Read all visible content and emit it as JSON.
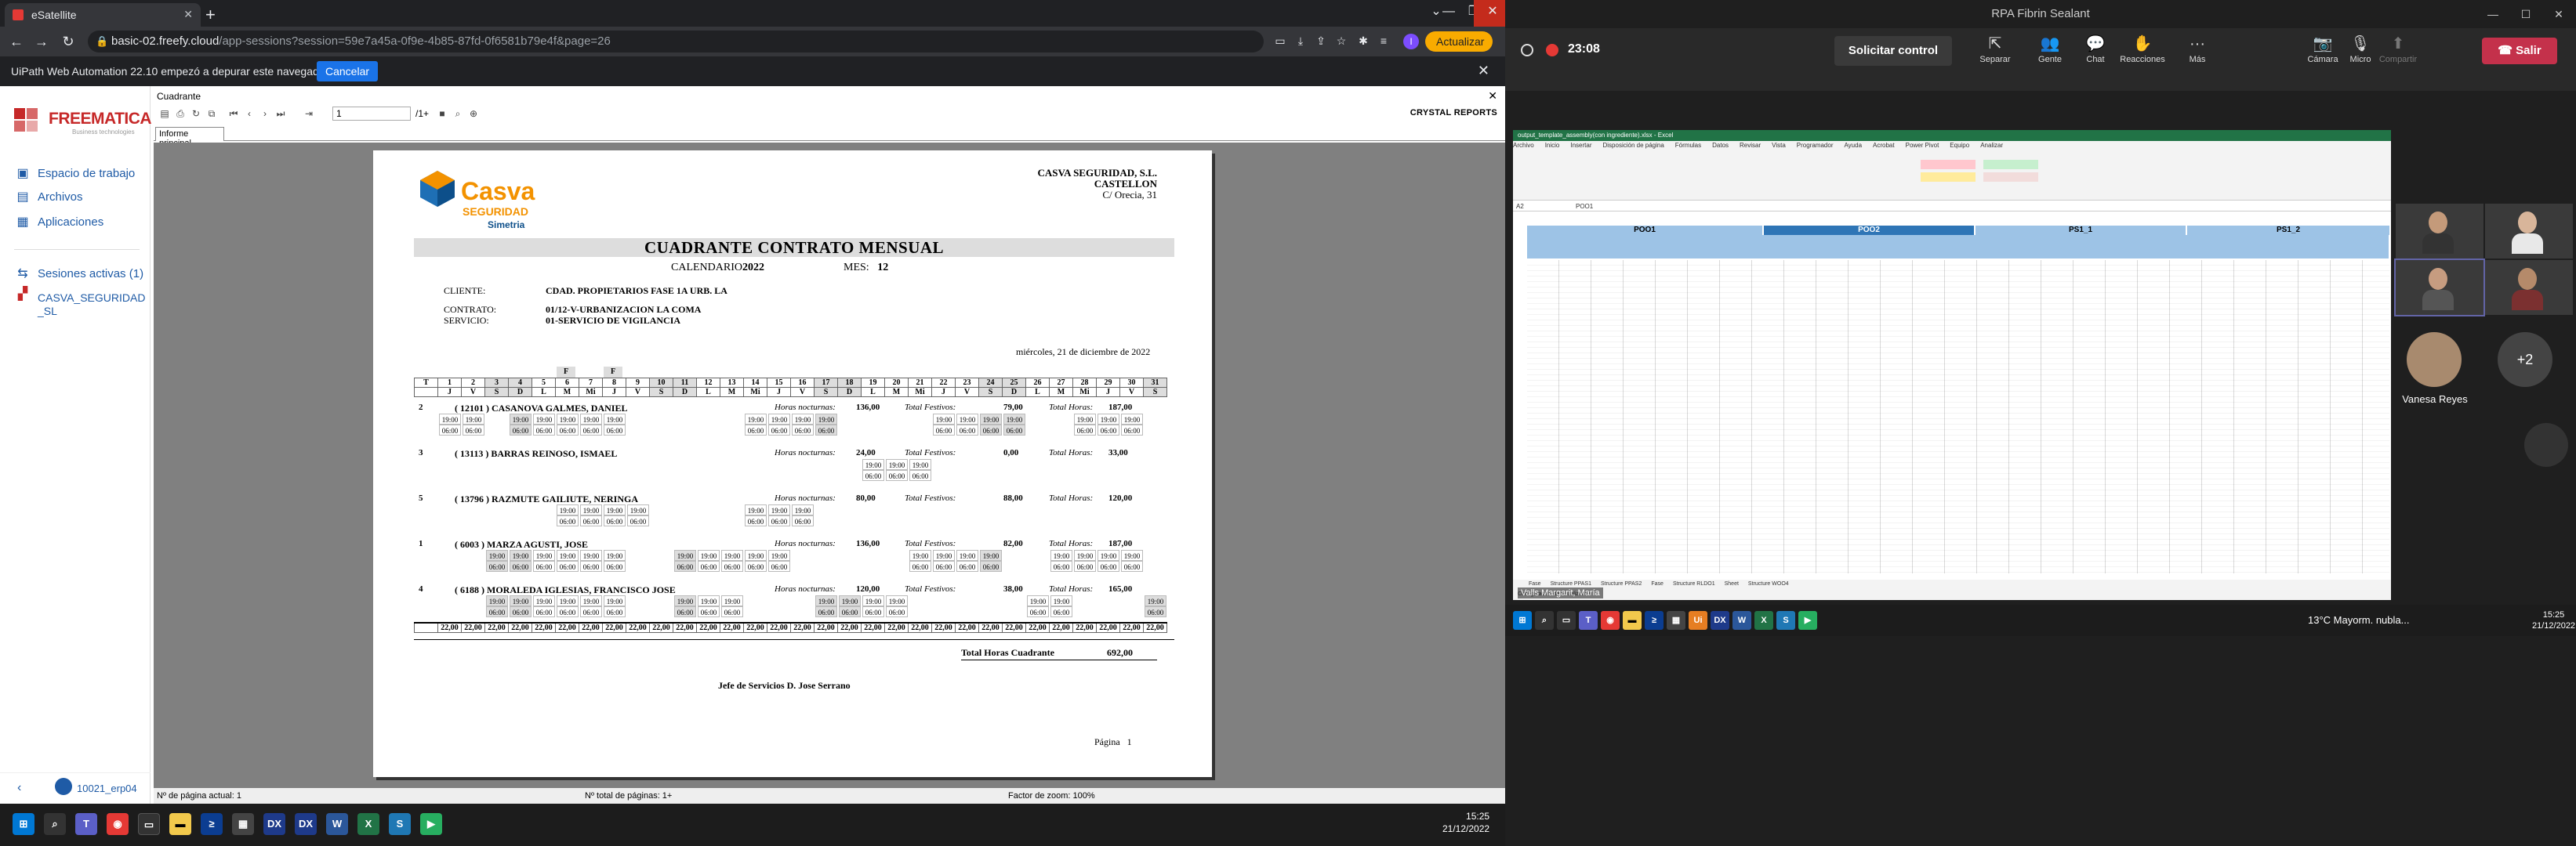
{
  "browser": {
    "tab_title": "eSatellite",
    "url_host": "basic-02.freefy.cloud",
    "url_path": "/app-sessions?session=59e7a45a-0f9e-4b85-87fd-0f6581b79e4f&page=26",
    "update_label": "Actualizar",
    "profile_initial": "I",
    "notice_text": "UiPath Web Automation 22.10 empezó a depurar este navegador",
    "notice_cancel": "Cancelar"
  },
  "sidebar": {
    "brand": "FREEMATICA",
    "brand_sub": "Business technologies",
    "items": [
      {
        "label": "Espacio de trabajo",
        "icon": "desktop-icon"
      },
      {
        "label": "Archivos",
        "icon": "folder-icon"
      },
      {
        "label": "Aplicaciones",
        "icon": "apps-icon"
      }
    ],
    "sessions_label": "Sesiones activas (1)",
    "session_item": "CASVA_SEGURIDAD_SL",
    "user": "10021_erp04"
  },
  "viewer": {
    "title": "Cuadrante",
    "page_input": "1",
    "page_total": "/1+",
    "brand": "CRYSTAL REPORTS",
    "tab": "Informe principal",
    "status_page": "Nº de página actual: 1",
    "status_total": "Nº total de páginas: 1+",
    "status_zoom": "Factor de zoom: 100%"
  },
  "report": {
    "company_name": "CASVA SEGURIDAD, S.L.",
    "company_city": "CASTELLON",
    "company_street": "C/ Orecia, 31",
    "logo_main": "Casva",
    "logo_seg": "SEGURIDAD",
    "logo_sub": "Simetria",
    "title": "CUADRANTE CONTRATO MENSUAL",
    "cal_label": "CALENDARIO",
    "cal_value": "2022",
    "mes_label": "MES:",
    "mes_value": "12",
    "cliente_label": "CLIENTE:",
    "cliente_value": "CDAD. PROPIETARIOS FASE 1A URB. LA",
    "contrato_label": "CONTRATO:",
    "contrato_value": "01/12-V-URBANIZACION LA COMA",
    "servicio_label": "SERVICIO:",
    "servicio_value": "01-SERVICIO DE VIGILANCIA",
    "date": "miércoles, 21 de diciembre de 2022",
    "festivo_mark": "F",
    "days": [
      "1",
      "2",
      "3",
      "4",
      "5",
      "6",
      "7",
      "8",
      "9",
      "10",
      "11",
      "12",
      "13",
      "14",
      "15",
      "16",
      "17",
      "18",
      "19",
      "20",
      "21",
      "22",
      "23",
      "24",
      "25",
      "26",
      "27",
      "28",
      "29",
      "30",
      "31"
    ],
    "weekdays": [
      "J",
      "V",
      "S",
      "D",
      "L",
      "M",
      "Mi",
      "J",
      "V",
      "S",
      "D",
      "L",
      "M",
      "Mi",
      "J",
      "V",
      "S",
      "D",
      "L",
      "M",
      "Mi",
      "J",
      "V",
      "S",
      "D",
      "L",
      "M",
      "Mi",
      "J",
      "V",
      "S"
    ],
    "hn_label": "Horas nocturnas:",
    "tf_label": "Total Festivos:",
    "th_label": "Total Horas:",
    "workers": [
      {
        "num": "2",
        "name": "( 12101 ) CASANOVA GALMES, DANIEL",
        "hn": "136,00",
        "tf": "79,00",
        "th": "187,00"
      },
      {
        "num": "3",
        "name": "( 13113 ) BARRAS REINOSO, ISMAEL",
        "hn": "24,00",
        "tf": "0,00",
        "th": "33,00"
      },
      {
        "num": "5",
        "name": "( 13796 ) RAZMUTE GAILIUTE, NERINGA",
        "hn": "80,00",
        "tf": "88,00",
        "th": "120,00"
      },
      {
        "num": "1",
        "name": "( 6003 ) MARZA AGUSTI, JOSE",
        "hn": "136,00",
        "tf": "82,00",
        "th": "187,00"
      },
      {
        "num": "4",
        "name": "( 6188 ) MORALEDA IGLESIAS, FRANCISCO JOSE",
        "hn": "120,00",
        "tf": "38,00",
        "th": "165,00"
      }
    ],
    "shift_start": "19:00",
    "shift_end": "06:00",
    "daily_total": "22,00",
    "total_label": "Total Horas Cuadrante",
    "total_value": "692,00",
    "jefe": "Jefe de Servicios D. Jose Serrano",
    "page_label": "Página",
    "page_value": "1"
  },
  "taskbar_left": {
    "time": "15:25",
    "date": "21/12/2022"
  },
  "meeting": {
    "window_title": "RPA Fibrin Sealant",
    "elapsed": "23:08",
    "request_control": "Solicitar control",
    "buttons": [
      {
        "label": "Separar",
        "icon": "popout-icon"
      },
      {
        "label": "Gente",
        "icon": "people-icon"
      },
      {
        "label": "Chat",
        "icon": "chat-icon"
      },
      {
        "label": "Reacciones",
        "icon": "reactions-icon"
      },
      {
        "label": "Más",
        "icon": "more-icon"
      },
      {
        "label": "Compartir",
        "icon": "share-icon"
      },
      {
        "label": "Cámara",
        "icon": "camera-icon"
      },
      {
        "label": "Micro",
        "icon": "mic-icon"
      }
    ],
    "leave": "Salir",
    "presenter": "Valls Margarit, María",
    "participant_name": "Vanesa Reyes",
    "more_count": "+2",
    "excel": {
      "title": "output_template_assembly(con ingrediente).xlsx - Excel",
      "menu": [
        "Archivo",
        "Inicio",
        "Insertar",
        "Disposición de página",
        "Fórmulas",
        "Datos",
        "Revisar",
        "Vista",
        "Programador",
        "Ayuda",
        "Acrobat",
        "Power Pivot",
        "Equipo",
        "Analizar"
      ],
      "cell_ref": "A2",
      "formula": "POO1",
      "groups": [
        "POO1",
        "POO2",
        "PS1_1",
        "PS1_2"
      ],
      "sheets": [
        "Fase",
        "Structure PPAS1",
        "Structure PPAS2",
        "Fase",
        "Structure RLDO1",
        "Sheet",
        "Structure WOO4"
      ],
      "status": "Configuración de visualización"
    },
    "weather": "13°C Mayorm. nubla...",
    "time": "15:25",
    "date": "21/12/2022"
  }
}
